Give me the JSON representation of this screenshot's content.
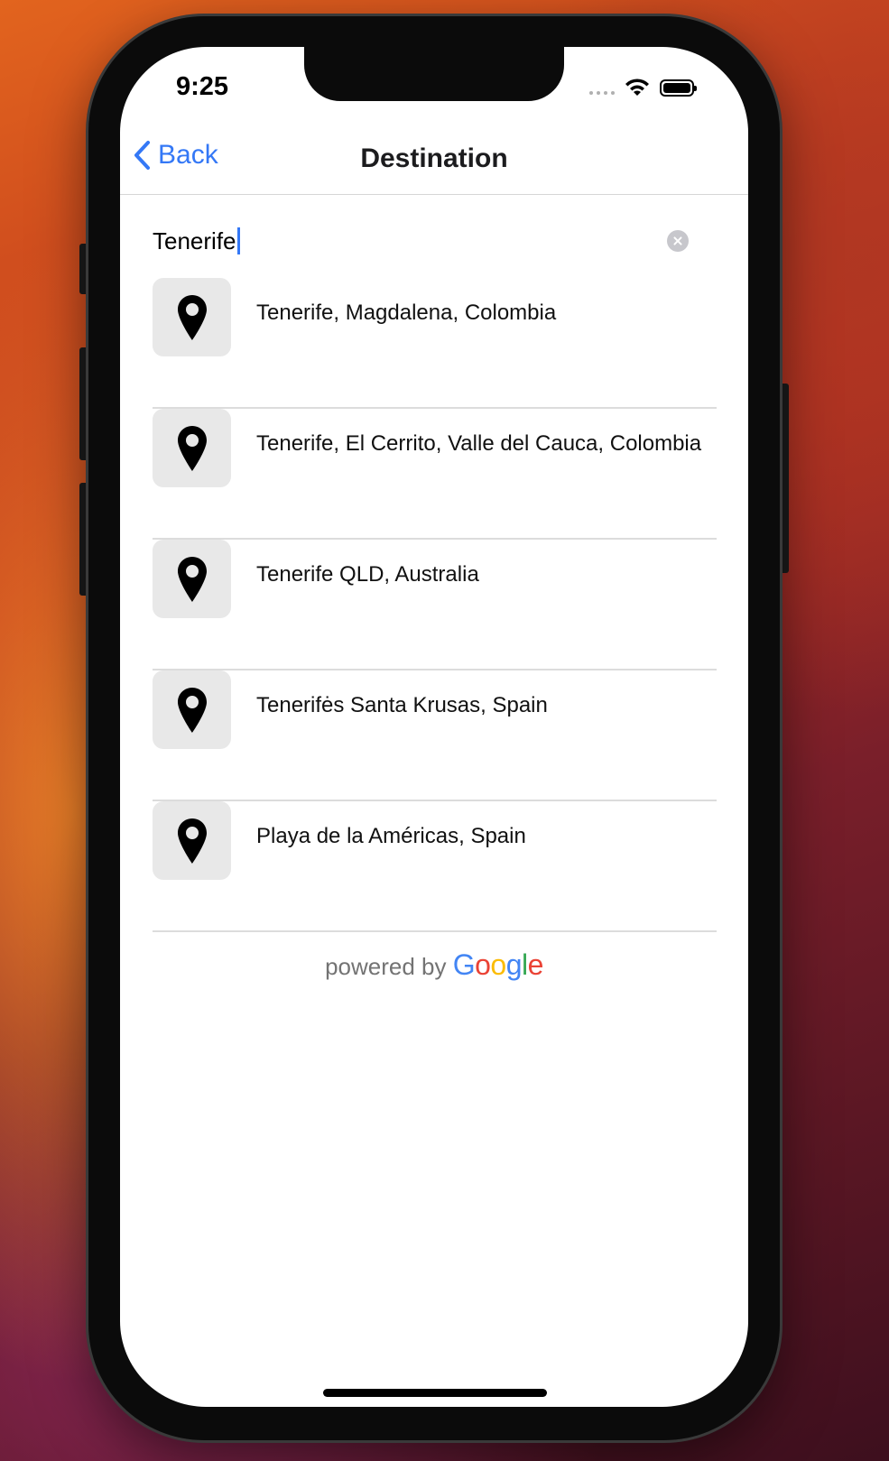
{
  "status_bar": {
    "time": "9:25"
  },
  "navbar": {
    "back_label": "Back",
    "title": "Destination"
  },
  "search": {
    "value": "Tenerife"
  },
  "results": [
    {
      "label": "Tenerife, Magdalena, Colombia"
    },
    {
      "label": "Tenerife, El Cerrito, Valle del Cauca, Colombia"
    },
    {
      "label": "Tenerife QLD, Australia"
    },
    {
      "label": "Tenerifės Santa Krusas, Spain"
    },
    {
      "label": "Playa de la Américas, Spain"
    }
  ],
  "attribution": {
    "powered_by": "powered by",
    "brand_letters": [
      "G",
      "o",
      "o",
      "g",
      "l",
      "e"
    ]
  },
  "colors": {
    "accent": "#3478f6",
    "google_blue": "#4285F4",
    "google_red": "#EA4335",
    "google_yellow": "#FBBC05",
    "google_green": "#34A853"
  },
  "icons": {
    "back": "chevron-left-icon",
    "clear": "clear-circle-icon",
    "result": "map-pin-icon",
    "wifi": "wifi-icon",
    "battery": "battery-icon",
    "signal": "cellular-signal-icon"
  }
}
